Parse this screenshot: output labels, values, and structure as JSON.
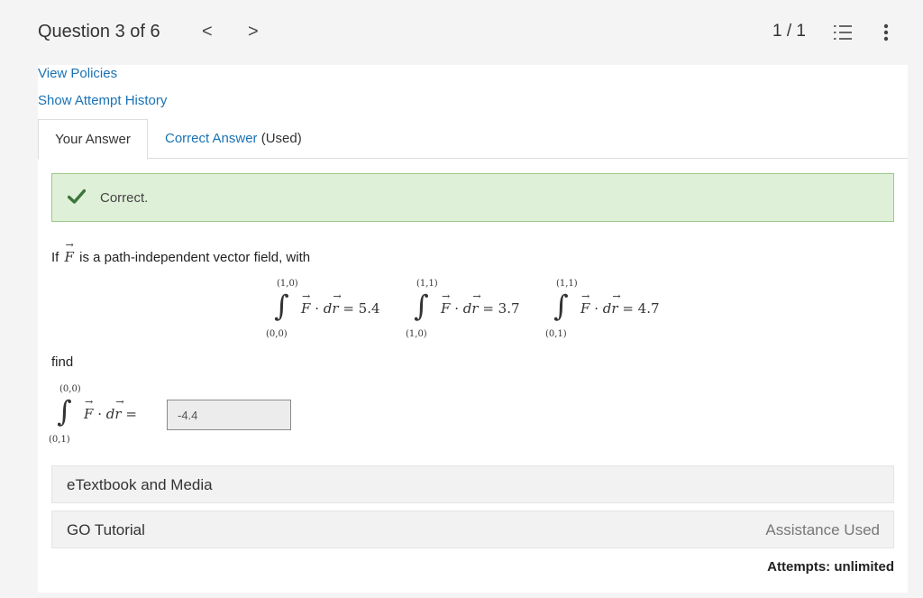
{
  "header": {
    "question_label": "Question 3 of 6",
    "prev_glyph": "<",
    "next_glyph": ">",
    "page_counter": "1 / 1"
  },
  "links": {
    "view_policies": "View Policies",
    "show_attempt_history": "Show Attempt History"
  },
  "tabs": {
    "your_answer": "Your Answer",
    "correct_answer": "Correct Answer",
    "correct_answer_suffix": "(Used)"
  },
  "feedback": {
    "status": "Correct."
  },
  "question": {
    "intro_prefix": "If",
    "intro_vector": "F",
    "intro_suffix": "is a path-independent vector field, with",
    "integrals": [
      {
        "upper": "(1,0)",
        "lower": "(0,0)",
        "value": "5.4"
      },
      {
        "upper": "(1,1)",
        "lower": "(1,0)",
        "value": "3.7"
      },
      {
        "upper": "(1,1)",
        "lower": "(0,1)",
        "value": "4.7"
      }
    ],
    "find_label": "find",
    "target": {
      "upper": "(0,0)",
      "lower": "(0,1)"
    },
    "answer_value": "-4.4"
  },
  "sections": {
    "etextbook": "eTextbook and Media",
    "go_tutorial": "GO Tutorial",
    "assistance": "Assistance Used"
  },
  "footer": {
    "attempts": "Attempts: unlimited"
  },
  "colors": {
    "link": "#1a73b5",
    "success_bg": "#dff0d8",
    "success_check": "#3c763d"
  },
  "icons": [
    "chevron-left-icon",
    "chevron-right-icon",
    "list-icon",
    "more-vertical-icon",
    "check-icon"
  ]
}
